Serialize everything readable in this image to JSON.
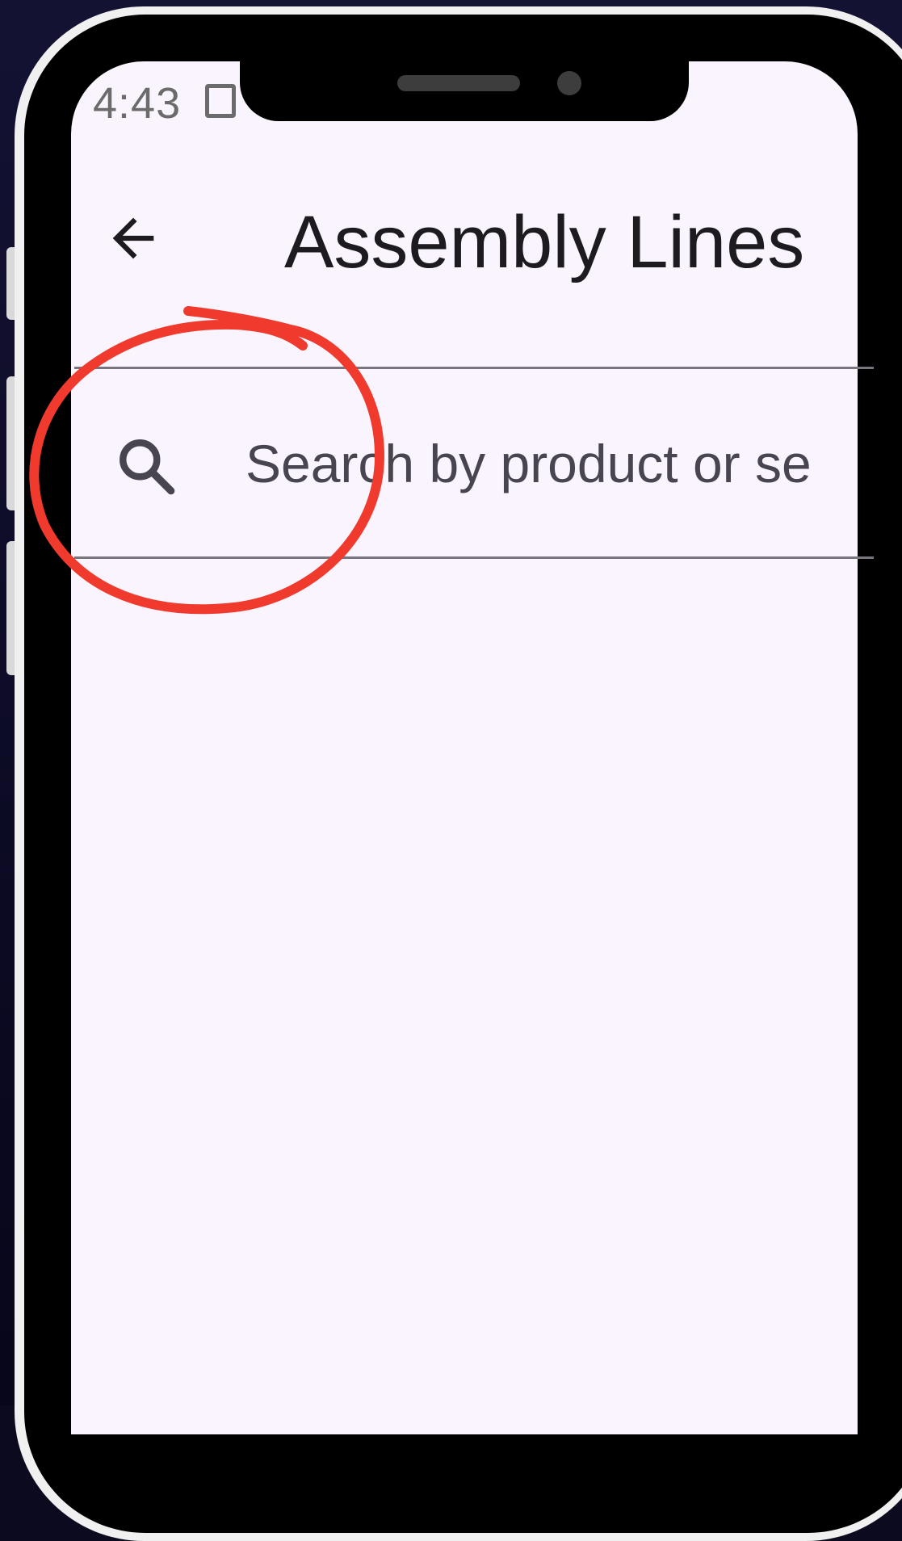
{
  "status_bar": {
    "time": "4:43",
    "icon": "screenshot-icon"
  },
  "app_bar": {
    "back_icon": "arrow-back-icon",
    "title": "Assembly Lines"
  },
  "search": {
    "icon": "search-icon",
    "placeholder": "Search by product or se"
  },
  "annotation": {
    "color": "#f03a2e",
    "shape": "hand-drawn circle around search-icon"
  },
  "colors": {
    "screen_bg": "#f9f4fd",
    "title_text": "#1d1b20",
    "placeholder_text": "#49454f",
    "outline": "#79747e"
  }
}
